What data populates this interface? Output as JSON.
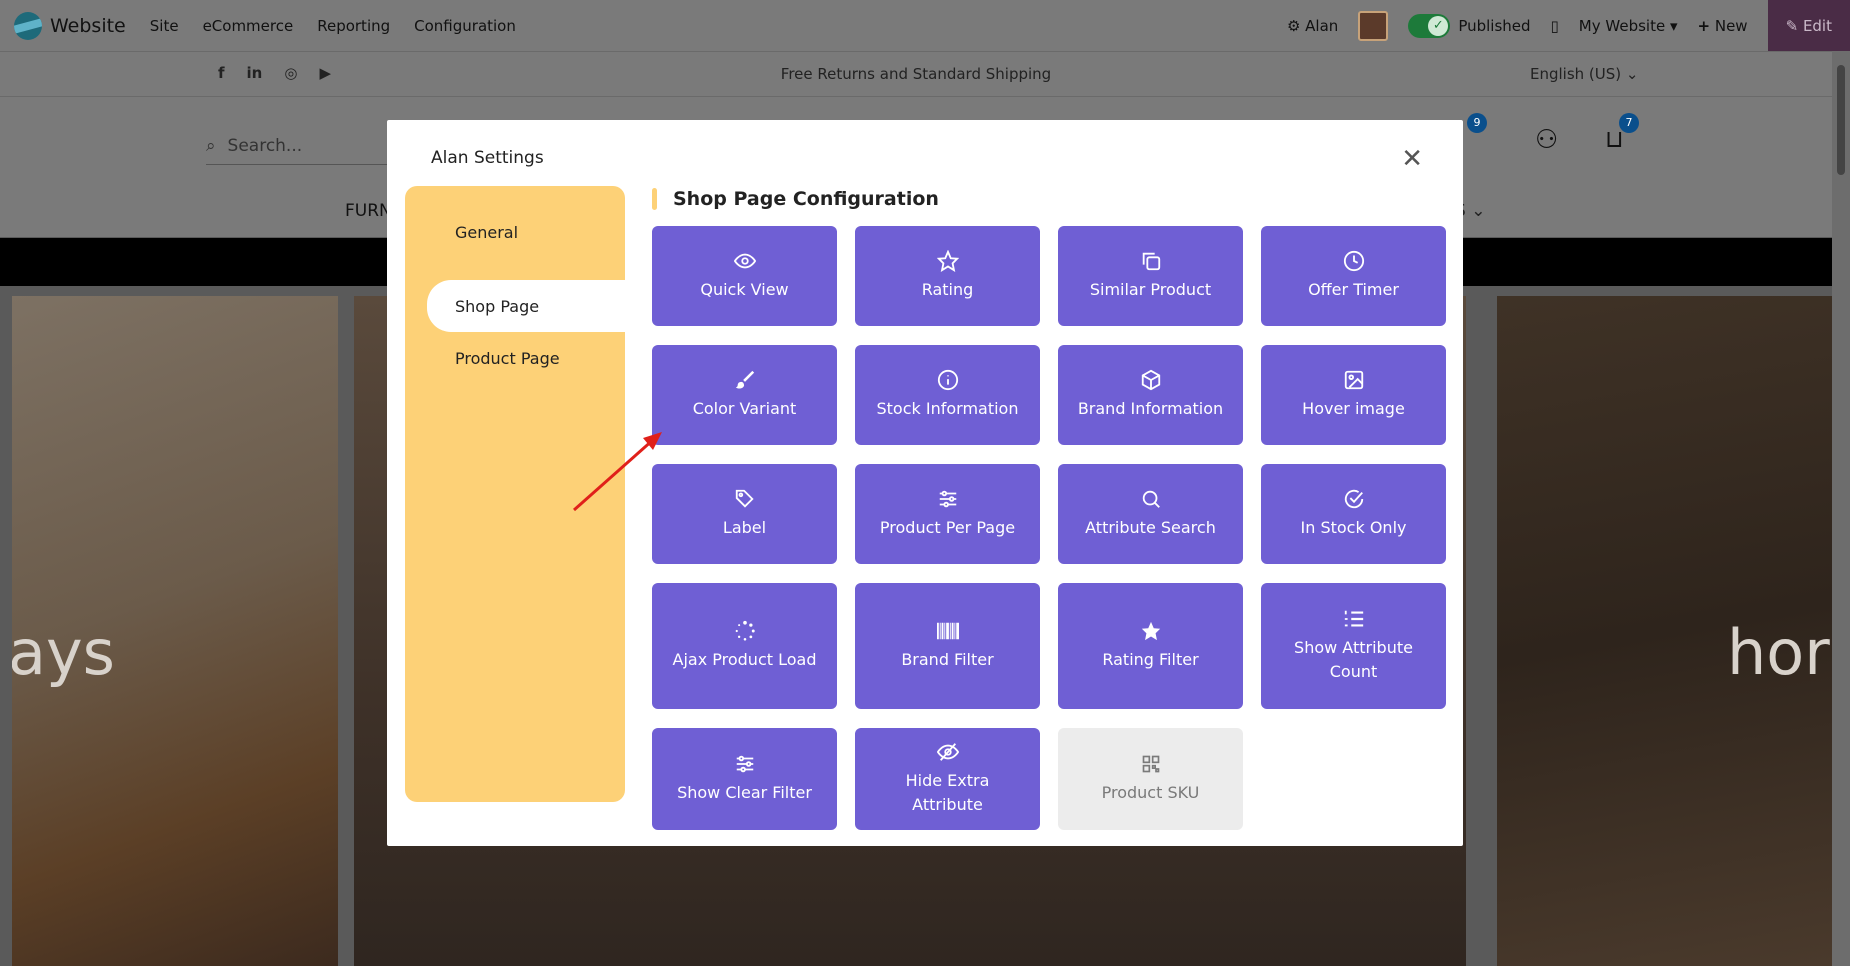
{
  "admin_bar": {
    "brand": "Website",
    "menu": [
      "Site",
      "eCommerce",
      "Reporting",
      "Configuration"
    ],
    "user": "Alan",
    "published_label": "Published",
    "website_selector": "My Website",
    "new_label": "New",
    "edit_label": "Edit"
  },
  "site": {
    "announcement": "Free Returns and Standard Shipping",
    "language": "English (US)",
    "search_placeholder": "Search...",
    "menu_partial": "FURN",
    "menu_partial_right": "S",
    "wishlist_count": "9",
    "cart_count": "7",
    "hero_left_word": "ays",
    "hero_right_word": "hor"
  },
  "modal": {
    "title": "Alan Settings",
    "sidebar": [
      {
        "label": "General",
        "active": false
      },
      {
        "label": "Shop Page",
        "active": true
      },
      {
        "label": "Product Page",
        "active": false
      }
    ],
    "section_title": "Shop Page Configuration",
    "tiles": [
      {
        "label": "Quick View",
        "icon": "eye-icon",
        "enabled": true
      },
      {
        "label": "Rating",
        "icon": "star-outline-icon",
        "enabled": true
      },
      {
        "label": "Similar Product",
        "icon": "copy-icon",
        "enabled": true
      },
      {
        "label": "Offer Timer",
        "icon": "clock-icon",
        "enabled": true
      },
      {
        "label": "Color Variant",
        "icon": "brush-icon",
        "enabled": true
      },
      {
        "label": "Stock Information",
        "icon": "info-icon",
        "enabled": true
      },
      {
        "label": "Brand Information",
        "icon": "cube-icon",
        "enabled": true
      },
      {
        "label": "Hover image",
        "icon": "image-icon",
        "enabled": true
      },
      {
        "label": "Label",
        "icon": "tag-icon",
        "enabled": true
      },
      {
        "label": "Product Per Page",
        "icon": "sliders-icon",
        "enabled": true
      },
      {
        "label": "Attribute Search",
        "icon": "search-icon",
        "enabled": true
      },
      {
        "label": "In Stock Only",
        "icon": "check-circle-icon",
        "enabled": true
      },
      {
        "label": "Ajax Product Load",
        "icon": "spinner-icon",
        "enabled": true
      },
      {
        "label": "Brand Filter",
        "icon": "barcode-icon",
        "enabled": true
      },
      {
        "label": "Rating Filter",
        "icon": "star-filled-icon",
        "enabled": true
      },
      {
        "label": "Show Attribute Count",
        "icon": "list-numbered-icon",
        "enabled": true
      },
      {
        "label": "Show Clear Filter",
        "icon": "sliders-icon",
        "enabled": true
      },
      {
        "label": "Hide Extra Attribute",
        "icon": "eye-slash-icon",
        "enabled": true
      },
      {
        "label": "Product SKU",
        "icon": "qr-icon",
        "enabled": false
      }
    ]
  },
  "colors": {
    "tile": "#6f5fd4",
    "tile_disabled": "#ececec",
    "sidebar": "#fdd177",
    "arrow": "#e0201a"
  }
}
